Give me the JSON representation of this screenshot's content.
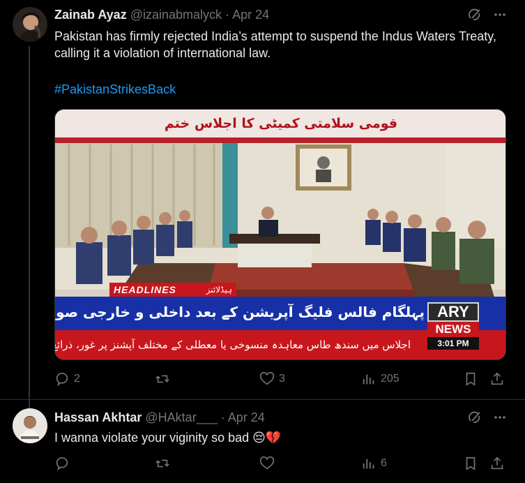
{
  "tweets": [
    {
      "author_name": "Zainab Ayaz",
      "handle": "@izainabmalyck",
      "separator": "·",
      "date": "Apr 24",
      "text": "Pakistan has firmly rejected India’s attempt to suspend the Indus Waters Treaty, calling it a violation of international law.",
      "hashtag": "#PakistanStrikesBack",
      "media": {
        "top_banner": "قومی سلامتی کمیٹی کا اجلاس ختم",
        "headlines_label": "HEADLINES",
        "headlines_urdu": "ہیڈلائنز",
        "ticker_main": "پہلگام فالس فلیگ آپریشن کے بعد داخلی و خارجی صورتحال پر غور",
        "ticker_sub": "اجلاس میں سندھ طاس معاہدہ منسوخی یا معطلی کے مختلف آپشنز پر غور، ذرائع",
        "channel": "ARY",
        "channel_sub": "NEWS",
        "time": "3:01 PM"
      },
      "replies": "2",
      "reposts": "",
      "likes": "3",
      "views": "205"
    },
    {
      "author_name": "Hassan Akhtar",
      "handle": "@HAktar___",
      "separator": "·",
      "date": "Apr 24",
      "text": "I wanna violate your viginity so bad 😔💔",
      "replies": "",
      "reposts": "",
      "likes": "",
      "views": "6"
    }
  ],
  "icons": {
    "grok": "grok-icon",
    "more": "more-icon",
    "reply": "reply-icon",
    "repost": "repost-icon",
    "like": "like-icon",
    "views": "views-icon",
    "bookmark": "bookmark-icon",
    "share": "share-icon"
  },
  "colors": {
    "background": "#000000",
    "text": "#e7e9ea",
    "muted": "#71767b",
    "link": "#1d9bf0",
    "ary_red": "#c8161d",
    "ary_blue": "#1730a6"
  }
}
